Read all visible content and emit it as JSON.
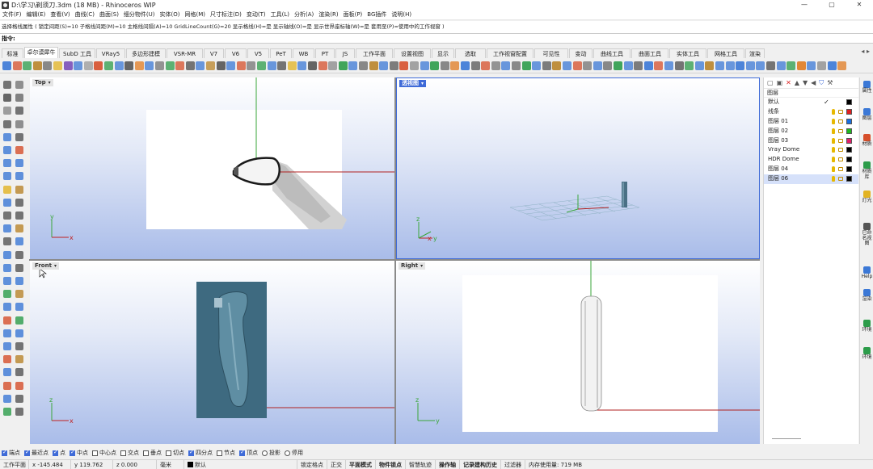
{
  "window": {
    "title": "D:\\学习\\剃须刀.3dm (18 MB) - Rhinoceros WIP",
    "controls": [
      "—",
      "▢",
      "✕"
    ]
  },
  "menu": [
    "文件(F)",
    "编辑(E)",
    "查看(V)",
    "曲线(C)",
    "曲面(S)",
    "细分物件(U)",
    "实体(O)",
    "网格(M)",
    "尺寸标注(D)",
    "变动(T)",
    "工具(L)",
    "分析(A)",
    "渲染(R)",
    "面板(P)",
    "BG插件",
    "说明(H)"
  ],
  "command": {
    "history": "选择格线属性 ( 锁定间距(S)=10  子格线间距(M)=10  主格线间隔(A)=10  GridLineCount(G)=20  显示格线(H)=是  显示轴线(O)=是  显示世界座标轴(W)=是  套用至(P)=使用中的工作视窗 )",
    "prompt": "指令:"
  },
  "tabs": [
    "标准",
    "卓尔谟犀牛",
    "SubD 工具",
    "VRay5",
    "多边形建模",
    "VSR-MR",
    "V7",
    "V6",
    "V5",
    "PeT",
    "WB",
    "PT",
    "JS",
    "工作平面",
    "设置视图",
    "显示",
    "选取",
    "工作视窗配置",
    "可见性",
    "变动",
    "曲线工具",
    "曲面工具",
    "实体工具",
    "网格工具",
    "渲染"
  ],
  "active_tab": 1,
  "viewports": {
    "top": {
      "label": "Top"
    },
    "perspective": {
      "label": "透视图"
    },
    "front": {
      "label": "Front"
    },
    "right": {
      "label": "Right"
    }
  },
  "axes": {
    "x": "x",
    "y": "y",
    "z": "z"
  },
  "layers": {
    "header": "图层",
    "rows": [
      {
        "name": "默认",
        "color": "#000000",
        "current": true
      },
      {
        "name": "线条",
        "color": "#e02020"
      },
      {
        "name": "图层 01",
        "color": "#1a6fe0"
      },
      {
        "name": "图层 02",
        "color": "#1fb81f"
      },
      {
        "name": "图层 03",
        "color": "#e0206a"
      },
      {
        "name": "Vray Dome",
        "color": "#000000"
      },
      {
        "name": "HDR Dome",
        "color": "#000000"
      },
      {
        "name": "图层 04",
        "color": "#000000"
      },
      {
        "name": "图层 06",
        "color": "#000000",
        "selected": true
      }
    ]
  },
  "right_tabs": [
    "属性",
    "图层",
    "材质",
    "材质库",
    "灯光",
    "已命名视图",
    "Help",
    "渲染",
    "环境",
    "环境"
  ],
  "osnaps": [
    {
      "label": "端点",
      "on": true
    },
    {
      "label": "最近点",
      "on": true
    },
    {
      "label": "点",
      "on": true
    },
    {
      "label": "中点",
      "on": true
    },
    {
      "label": "中心点",
      "on": false
    },
    {
      "label": "交点",
      "on": false
    },
    {
      "label": "垂点",
      "on": false
    },
    {
      "label": "切点",
      "on": false
    },
    {
      "label": "四分点",
      "on": true
    },
    {
      "label": "节点",
      "on": false
    },
    {
      "label": "顶点",
      "on": true
    },
    {
      "label": "投影",
      "on": false,
      "radio": true
    },
    {
      "label": "停用",
      "on": false,
      "radio": true
    }
  ],
  "status": {
    "cplane": "工作平面",
    "x": "x -145.484",
    "y": "y 119.762",
    "z": "z 0.000",
    "unit": "毫米",
    "layer": "默认",
    "toggles": [
      "锁定格点",
      "正交",
      "平面模式",
      "物件锁点",
      "智慧轨迹",
      "操作轴",
      "记录建构历史",
      "过滤器"
    ],
    "bold_toggles": [
      "平面模式",
      "物件锁点",
      "操作轴",
      "记录建构历史"
    ],
    "memory": "内存使用量: 719 MB"
  }
}
